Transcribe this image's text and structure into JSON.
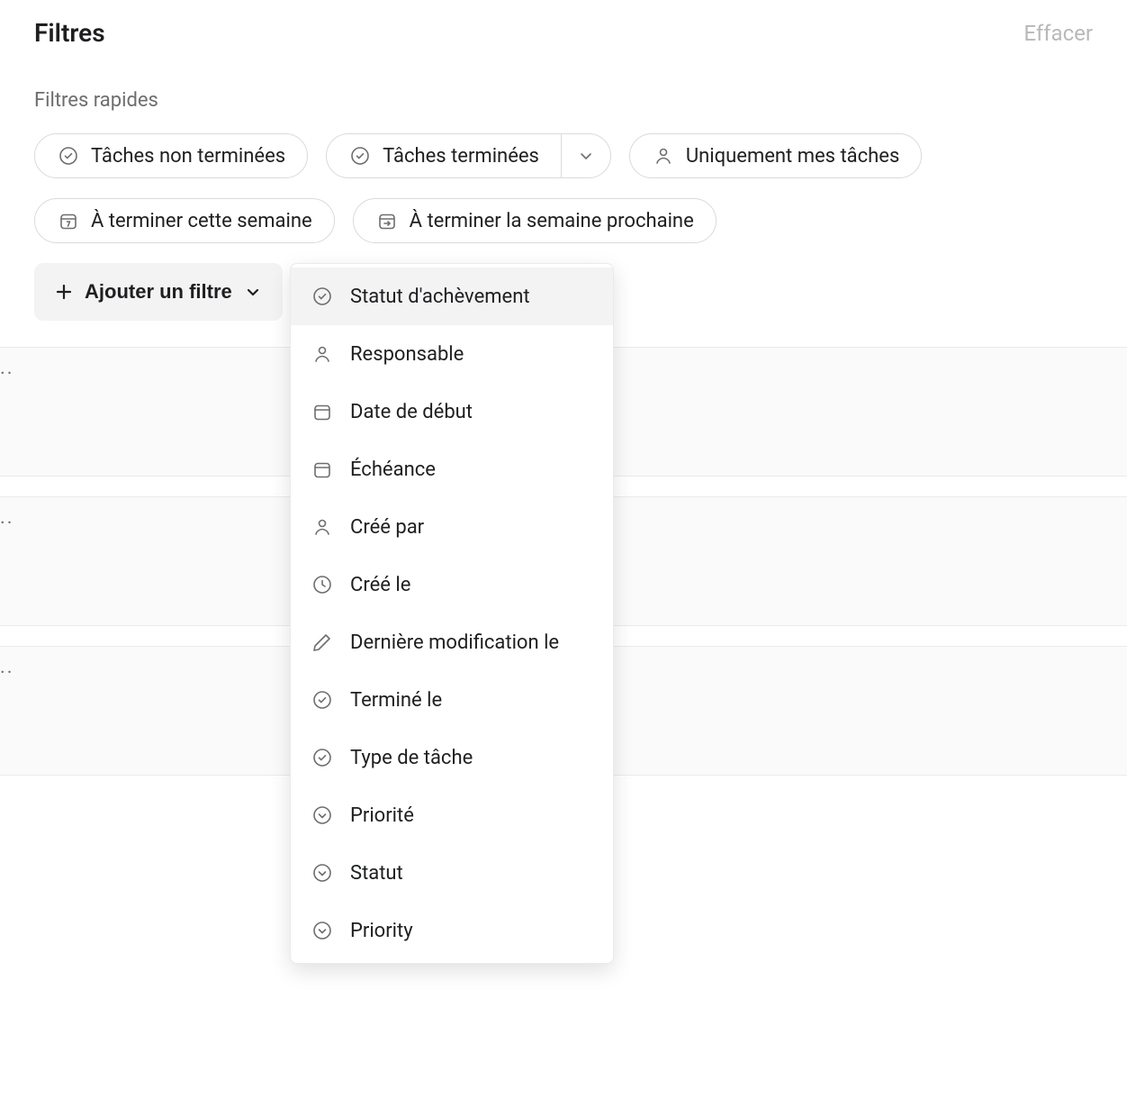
{
  "header": {
    "title": "Filtres",
    "clear": "Effacer"
  },
  "quick": {
    "label": "Filtres rapides",
    "chips": {
      "incomplete": "Tâches non terminées",
      "complete": "Tâches terminées",
      "mine": "Uniquement mes tâches",
      "this_week": "À terminer cette semaine",
      "next_week": "À terminer la semaine prochaine"
    }
  },
  "add_filter": {
    "label": "Ajouter un filtre"
  },
  "menu": {
    "items": [
      {
        "key": "completion_status",
        "label": "Statut d'achèvement",
        "icon": "check-circle"
      },
      {
        "key": "assignee",
        "label": "Responsable",
        "icon": "person"
      },
      {
        "key": "start_date",
        "label": "Date de début",
        "icon": "calendar"
      },
      {
        "key": "due_date",
        "label": "Échéance",
        "icon": "calendar"
      },
      {
        "key": "created_by",
        "label": "Créé par",
        "icon": "person"
      },
      {
        "key": "created_on",
        "label": "Créé le",
        "icon": "clock"
      },
      {
        "key": "last_modified",
        "label": "Dernière modification le",
        "icon": "pencil"
      },
      {
        "key": "completed_on",
        "label": "Terminé le",
        "icon": "check-circle"
      },
      {
        "key": "task_type",
        "label": "Type de tâche",
        "icon": "check-circle"
      },
      {
        "key": "priority_fr",
        "label": "Priorité",
        "icon": "chevron-circle"
      },
      {
        "key": "status",
        "label": "Statut",
        "icon": "chevron-circle"
      },
      {
        "key": "priority_en",
        "label": "Priority",
        "icon": "chevron-circle"
      }
    ]
  },
  "bg": {
    "dots": ".."
  }
}
